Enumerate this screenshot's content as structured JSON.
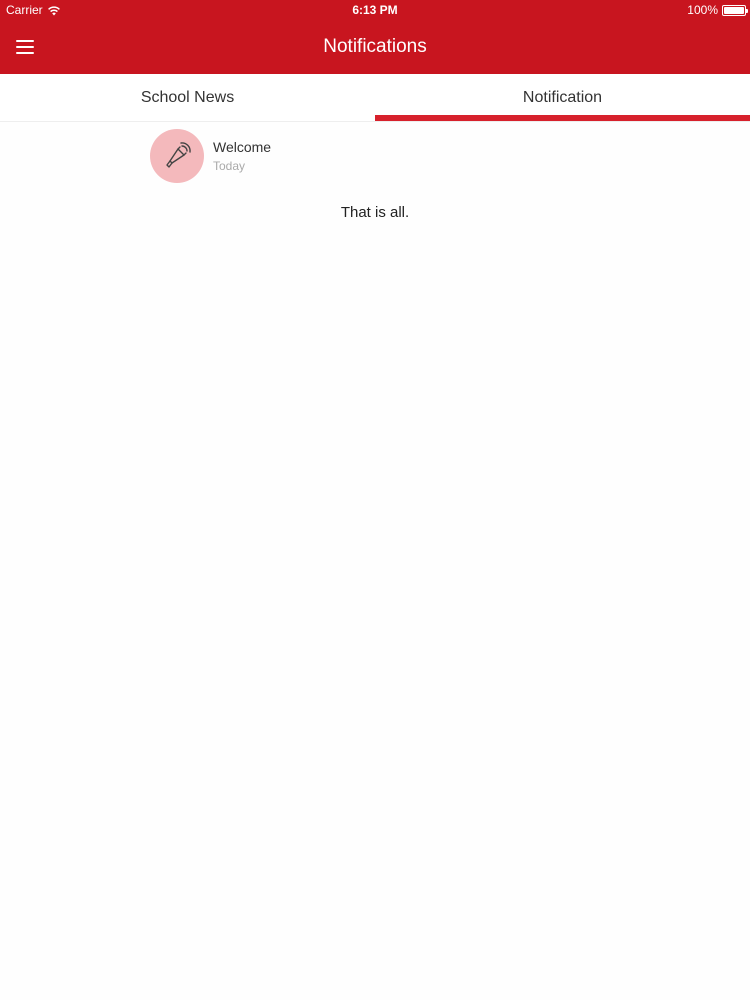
{
  "status_bar": {
    "carrier": "Carrier",
    "time": "6:13 PM",
    "battery": "100%",
    "battery_level": 1.0
  },
  "header": {
    "title": "Notifications",
    "menu_icon": "hamburger-menu-icon",
    "background_color": "#c8151f"
  },
  "tabs": [
    {
      "label": "School News",
      "active": false
    },
    {
      "label": "Notification",
      "active": true
    }
  ],
  "notifications": [
    {
      "title": "Welcome",
      "date": "Today",
      "icon": "megaphone-icon"
    }
  ],
  "end_message": "That is all.",
  "colors": {
    "accent": "#d7212c",
    "avatar_bg": "#f4b9bc"
  }
}
